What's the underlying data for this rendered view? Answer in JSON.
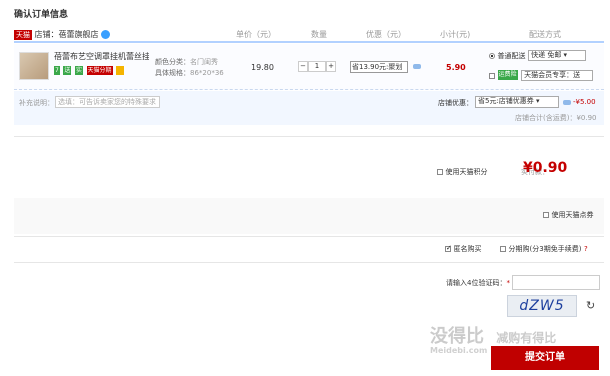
{
  "page_title": "确认订单信息",
  "header": {
    "cols": [
      "单价（元）",
      "数量",
      "优惠（元）",
      "小计(元)",
      "配送方式"
    ]
  },
  "shop": {
    "tmall_logo": "天猫",
    "label": "店铺：",
    "name": "蓓蕾旗舰店"
  },
  "item": {
    "name": "蓓蕾布艺空调罩挂机蕾丝挂...",
    "tags": [
      "7",
      "送",
      "实",
      "天猫分期"
    ],
    "attr1_label": "颜色分类：",
    "attr1_value": "名门闺秀",
    "attr2_label": "具体规格：",
    "attr2_value": "86*20*36",
    "price": "19.80",
    "quantity": "1",
    "promo": "省13.90元:聚划",
    "subtotal": "5.90",
    "shipping": {
      "normal_label": "普通配送",
      "normal_select": "快递 免邮",
      "freight_badge": "运费险",
      "freight_select": "天猫会员专享：送"
    }
  },
  "remark": {
    "label": "补充说明：",
    "placeholder": "选填：可告诉卖家您的特殊要求"
  },
  "shop_discount": {
    "label": "店铺优惠：",
    "select": "省5元:店铺优惠券",
    "amount": "-¥5.00",
    "total_label": "店铺合计(含运费)：",
    "total_value": "¥0.90"
  },
  "points": {
    "label": "使用天猫积分",
    "pay_label": "实付款：",
    "pay_amount": "¥0.90"
  },
  "tmall_points_coupon": {
    "label": "使用天猫点券"
  },
  "anonymous": {
    "label": "匿名购买",
    "installment_label": "分期购(分3期免手续费)",
    "help": "?"
  },
  "captcha": {
    "label": "请输入4位验证码：",
    "required": "*",
    "image_text": "dZW5",
    "refresh_icon": "refresh-icon"
  },
  "submit": {
    "label": "提交订单"
  },
  "watermark": {
    "main": "没得比",
    "sub": "Meidebi.com",
    "slogan": "减购有得比"
  },
  "colors": {
    "accent_red": "#c40000",
    "header_border": "#b2d1ff",
    "row_bg": "#f2f7ff"
  }
}
